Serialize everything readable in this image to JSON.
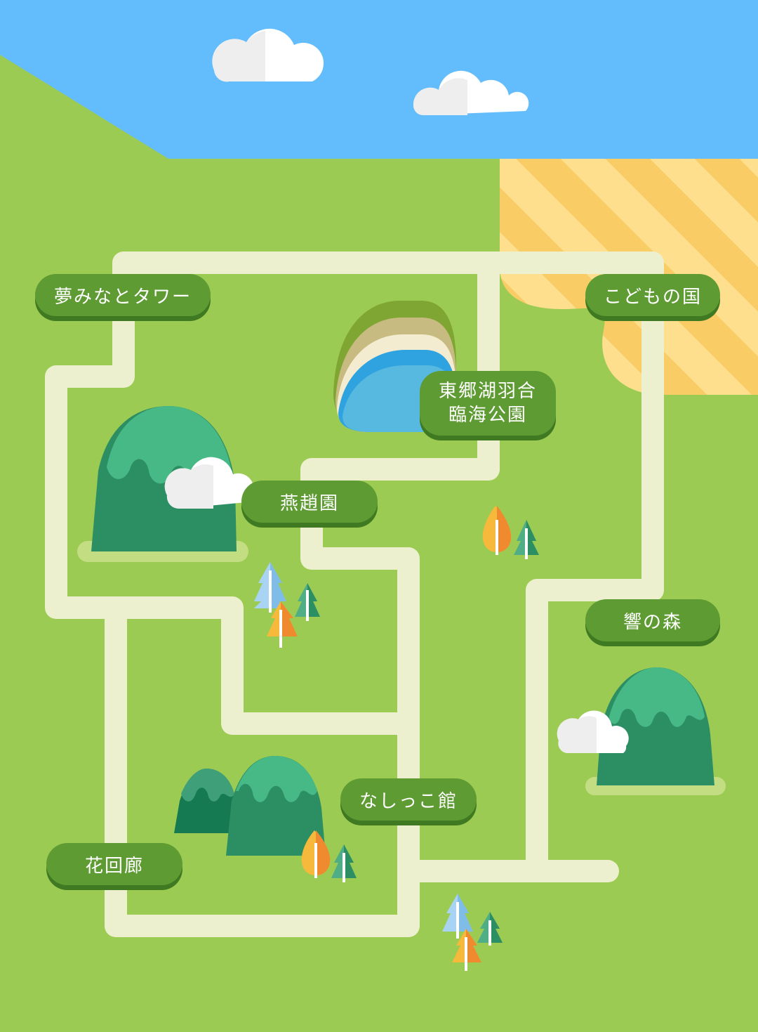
{
  "colors": {
    "sky": "#63bcfb",
    "grass": "#9ccb53",
    "road": "#edf0cf",
    "sand_light": "#fddf8e",
    "sand_dark": "#f9cc66",
    "label_fill": "#5e9c33",
    "label_shadow": "#3f7a22",
    "mountain_cap": "#47b986",
    "mountain_body": "#2c8f64",
    "water": "#57b8e0"
  },
  "places": {
    "yume_minato_tower": {
      "name": "夢みなとタワー",
      "icon": "map-location-label"
    },
    "kodomo_no_kuni": {
      "name": "こどもの国",
      "icon": "map-location-label"
    },
    "togoko_park": {
      "name_line1": "東郷湖羽合",
      "name_line2": "臨海公園",
      "icon": "map-location-label"
    },
    "enshoen": {
      "name": "燕趙園",
      "icon": "map-location-label"
    },
    "hibiki_no_mori": {
      "name": "響の森",
      "icon": "map-location-label"
    },
    "nashikko_kan": {
      "name": "なしっこ館",
      "icon": "map-location-label"
    },
    "hana_kairo": {
      "name": "花回廊",
      "icon": "map-location-label"
    }
  },
  "decorations": {
    "icons": [
      "cloud-icon",
      "mountain-icon",
      "tree-icon",
      "lake-icon",
      "road-network"
    ]
  }
}
